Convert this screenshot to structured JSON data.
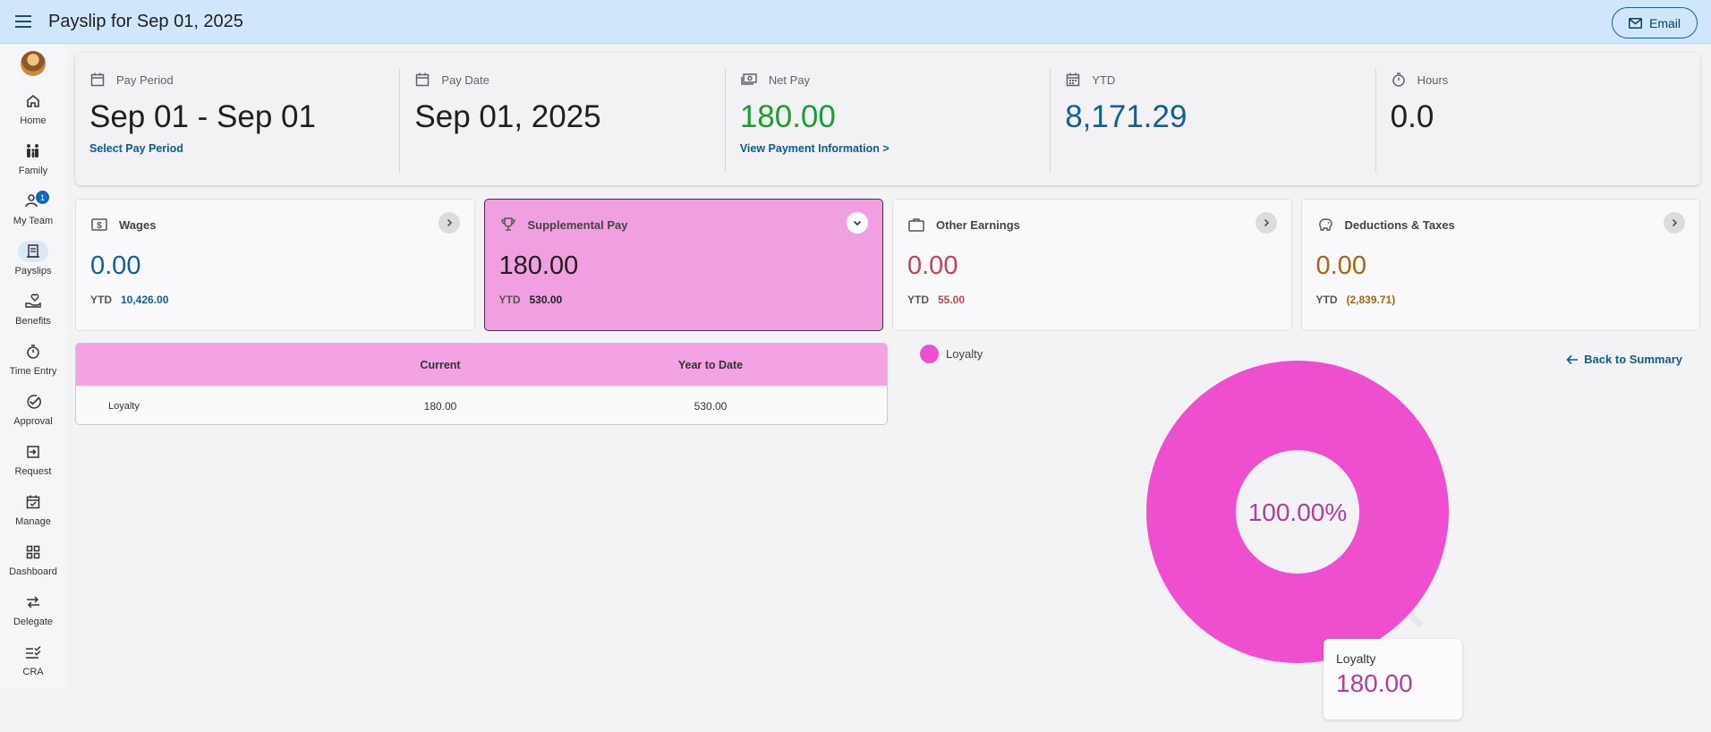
{
  "header": {
    "title": "Payslip for Sep 01, 2025",
    "email_label": "Email"
  },
  "sidebar": {
    "items": [
      {
        "label": "Home",
        "icon": "home-icon"
      },
      {
        "label": "Family",
        "icon": "family-icon"
      },
      {
        "label": "My Team",
        "icon": "team-icon",
        "badge": "1"
      },
      {
        "label": "Payslips",
        "icon": "payslip-icon",
        "active": true
      },
      {
        "label": "Benefits",
        "icon": "benefits-icon"
      },
      {
        "label": "Time Entry",
        "icon": "timer-icon"
      },
      {
        "label": "Approval",
        "icon": "check-circle-icon"
      },
      {
        "label": "Request",
        "icon": "request-icon"
      },
      {
        "label": "Manage",
        "icon": "calendar-check-icon"
      },
      {
        "label": "Dashboard",
        "icon": "dashboard-icon"
      },
      {
        "label": "Delegate",
        "icon": "swap-icon"
      },
      {
        "label": "CRA",
        "icon": "checklist-icon"
      }
    ]
  },
  "summary": {
    "pay_period": {
      "label": "Pay Period",
      "value": "Sep 01 - Sep 01",
      "link": "Select Pay Period"
    },
    "pay_date": {
      "label": "Pay Date",
      "value": "Sep 01, 2025"
    },
    "net_pay": {
      "label": "Net Pay",
      "value": "180.00",
      "link": "View Payment Information >",
      "color": "#1a9e2f"
    },
    "ytd": {
      "label": "YTD",
      "value": "8,171.29",
      "color": "#0d6196"
    },
    "hours": {
      "label": "Hours",
      "value": "0.0"
    }
  },
  "cards": [
    {
      "title": "Wages",
      "value": "0.00",
      "ytd_label": "YTD",
      "ytd": "10,426.00",
      "color": "#0d6196"
    },
    {
      "title": "Supplemental Pay",
      "value": "180.00",
      "ytd_label": "YTD",
      "ytd": "530.00",
      "color": "#1f1f1f",
      "active": true
    },
    {
      "title": "Other Earnings",
      "value": "0.00",
      "ytd_label": "YTD",
      "ytd": "55.00",
      "color": "#c0454f"
    },
    {
      "title": "Deductions & Taxes",
      "value": "0.00",
      "ytd_label": "YTD",
      "ytd": "(2,839.71)",
      "color": "#a8670a"
    }
  ],
  "table": {
    "columns": [
      "",
      "Current",
      "Year to Date"
    ],
    "rows": [
      {
        "name": "Loyalty",
        "current": "180.00",
        "ytd": "530.00"
      }
    ]
  },
  "chart_data": {
    "type": "pie",
    "categories": [
      "Loyalty"
    ],
    "values": [
      180.0
    ],
    "center_label": "100.00%",
    "legend": [
      "Loyalty"
    ],
    "legend_position": "top-left",
    "colors": [
      "#ee4fcf"
    ],
    "tooltip": {
      "label": "Loyalty",
      "value": "180.00"
    }
  },
  "back_link": "Back to Summary"
}
